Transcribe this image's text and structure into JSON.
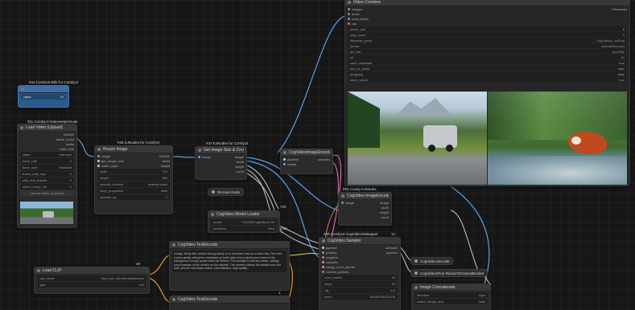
{
  "colors": {
    "canvas": "#161616",
    "wire_image": "#5aa0e6",
    "wire_model": "#c8c8c8",
    "wire_clip": "#e0d060",
    "wire_cond": "#e07070",
    "wire_latent": "#e87ac8",
    "wire_orange": "#e09a3a",
    "blue_node": "#2c5a8a"
  },
  "icons": {
    "node_dot": "dot-icon",
    "arrow": "arrow-icon"
  },
  "node_bubble": {
    "badge": "#44 ComfyUI-Rife for ComfyUI",
    "label": "value",
    "value": "24"
  },
  "node_load_image": {
    "badge": "#11 ComfyUI-VideoHelperSuite",
    "title": "Load Video (Upload)",
    "outputs": [
      "IMAGE",
      "frame_count",
      "audio",
      "video_info"
    ],
    "rows": [
      {
        "k": "video",
        "v": "test.mp4"
      },
      {
        "k": "force_rate",
        "v": "0"
      },
      {
        "k": "force_size",
        "v": "Disabled"
      },
      {
        "k": "frame_load_cap",
        "v": "0"
      },
      {
        "k": "skip_first_frames",
        "v": "0"
      },
      {
        "k": "select_every_nth",
        "v": "1"
      }
    ],
    "upload_label": "choose video to upload"
  },
  "node_resize": {
    "badge": "#45 KJNodes for ComfyUI",
    "title": "Resize Image",
    "rows": [
      {
        "k": "width",
        "v": "720"
      },
      {
        "k": "height",
        "v": "480"
      },
      {
        "k": "upscale_method",
        "v": "nearest-exact"
      },
      {
        "k": "keep_proportion",
        "v": "false"
      },
      {
        "k": "divisible_by",
        "v": "2"
      }
    ]
  },
  "node_get_size": {
    "badge": "#47 KJNodes for ComfyUI",
    "title": "Get Image Size & Count",
    "outputs": [
      "image",
      "width",
      "height",
      "count"
    ]
  },
  "node_reroute": {
    "badge": "#46 ComfyUI-KJNodes",
    "label": "Reroute Node"
  },
  "node_cogvideo_loader": {
    "badge": "",
    "title": "CogVideo Model Loader",
    "rows": [
      {
        "k": "model",
        "v": "THUDM/CogVideoX-5b"
      },
      {
        "k": "precision",
        "v": "bf16"
      }
    ]
  },
  "node_sampler_top": {
    "badge": "",
    "title": "CogVideoImageEncode",
    "inputs": [
      "pipeline",
      "image"
    ],
    "outputs": [
      "samples"
    ]
  },
  "node_text_pos": {
    "badge": "",
    "title": "CogVideo TextEncode",
    "text": "A large Jimny-like vehicle driving slowly on a mountain road on a clear day. The road curves gently with green meadows on both sides and a dense pine forest in the background, snowy peaks tower far behind. The sunlight is soft and warm, casting long shadows of the vehicle on the asphalt. The camera follows the vehicle from the side, smooth cinematic motion, ultra detailed, high quality."
  },
  "node_text_neg": {
    "badge": "",
    "title": "CogVideo TextEncode"
  },
  "node_clip": {
    "badge": "",
    "title": "Load CLIP",
    "rows": [
      {
        "k": "clip_name",
        "v": "t5xxl_fp8_e4m3fn.safetensors"
      },
      {
        "k": "type",
        "v": "sd3"
      }
    ]
  },
  "node_sampler": {
    "badge": "#49 ComfyUI-CogVideoXWrapper",
    "title": "CogVideo Sampler",
    "inputs": [
      "pipeline",
      "positive",
      "negative",
      "samples",
      "image_cond_latents",
      "context_options",
      "controlnet",
      "tora_trajectory",
      "fastercache"
    ],
    "rows": [
      {
        "k": "num_frames",
        "v": "49"
      },
      {
        "k": "steps",
        "v": "50"
      },
      {
        "k": "cfg",
        "v": "6.0"
      },
      {
        "k": "seed",
        "v": "65334758276105"
      },
      {
        "k": "control_after_generate",
        "v": "fixed"
      },
      {
        "k": "scheduler",
        "v": "CogVideoXDDIM"
      },
      {
        "k": "denoise_strength",
        "v": "0.80"
      }
    ]
  },
  "node_downscale": {
    "badge": "#53 Comfy-KJNodes",
    "title": "CogVideo ImageEncode",
    "outputs": [
      "image",
      "width",
      "height",
      "count"
    ]
  },
  "mini_nodes": [
    "CogVideo Decode",
    "CogVideoXFun ResizeToClosestBucket",
    "Image Concatenate"
  ],
  "node_combine": {
    "badge": "",
    "title": "Video Combine",
    "inputs": [
      "images",
      "audio",
      "meta_batch",
      "vae"
    ],
    "rows": [
      {
        "k": "frame_rate",
        "v": "8"
      },
      {
        "k": "loop_count",
        "v": "0"
      },
      {
        "k": "filename_prefix",
        "v": "CogVideoX_vid2vid"
      },
      {
        "k": "format",
        "v": "video/h264-mp4"
      },
      {
        "k": "pix_fmt",
        "v": "yuv420p"
      },
      {
        "k": "crf",
        "v": "19"
      },
      {
        "k": "save_metadata",
        "v": "true"
      },
      {
        "k": "trim_to_audio",
        "v": "false"
      },
      {
        "k": "pingpong",
        "v": "false"
      },
      {
        "k": "save_output",
        "v": "true"
      }
    ]
  },
  "node_concat": {
    "badge": "",
    "title": "Image Concatenate",
    "rows": [
      {
        "k": "direction",
        "v": "right"
      },
      {
        "k": "match_image_size",
        "v": "false"
      }
    ]
  },
  "link_labels": [
    "720",
    "480",
    "49",
    "1",
    "14"
  ]
}
